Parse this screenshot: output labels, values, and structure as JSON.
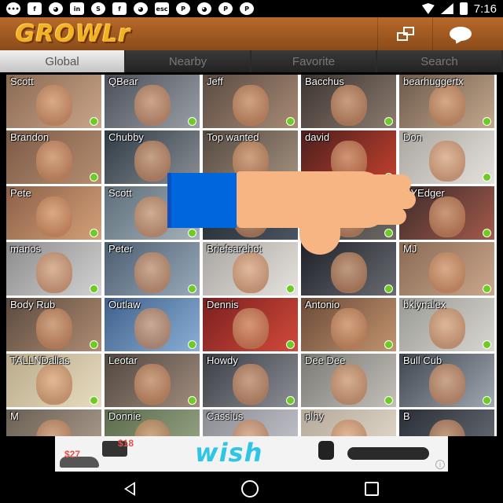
{
  "status_bar": {
    "time": "7:16",
    "notification_icons": [
      "messenger-icon",
      "facebook-icon",
      "growl-icon",
      "linkedin-icon",
      "skype-icon",
      "facebook-icon",
      "growl-icon",
      "esc-icon",
      "pinterest-icon",
      "growl-icon",
      "pinterest-icon",
      "pinterest-icon"
    ],
    "right_icons": [
      "wifi-icon",
      "signal-icon",
      "battery-icon"
    ]
  },
  "header": {
    "logo": "GROWLr",
    "actions": [
      "windows-icon",
      "chat-icon"
    ]
  },
  "tabs": [
    {
      "label": "Global",
      "active": true
    },
    {
      "label": "Nearby",
      "active": false
    },
    {
      "label": "Favorite",
      "active": false
    },
    {
      "label": "Search",
      "active": false
    }
  ],
  "users": [
    {
      "name": "Scott",
      "online": true
    },
    {
      "name": "QBear",
      "online": true
    },
    {
      "name": "Jeff",
      "online": true
    },
    {
      "name": "Bacchus",
      "online": true
    },
    {
      "name": "bearhuggertx",
      "online": true
    },
    {
      "name": "Brandon",
      "online": true
    },
    {
      "name": "Chubby",
      "online": true
    },
    {
      "name": "Top wanted",
      "online": true
    },
    {
      "name": "david",
      "online": true
    },
    {
      "name": "Don",
      "online": true
    },
    {
      "name": "Pete",
      "online": true
    },
    {
      "name": "Scott",
      "online": true
    },
    {
      "name": "",
      "online": false
    },
    {
      "name": "",
      "online": true
    },
    {
      "name": "NYEdger",
      "online": true
    },
    {
      "name": "manos",
      "online": true
    },
    {
      "name": "Peter",
      "online": true
    },
    {
      "name": "Briefsarehot",
      "online": true
    },
    {
      "name": "",
      "online": true
    },
    {
      "name": "MJ",
      "online": true
    },
    {
      "name": "Body Rub",
      "online": true
    },
    {
      "name": "Outlaw",
      "online": true
    },
    {
      "name": "Dennis",
      "online": true
    },
    {
      "name": "Antonio",
      "online": true
    },
    {
      "name": "bklynalex",
      "online": true
    },
    {
      "name": "TALLNDallas",
      "online": true
    },
    {
      "name": "Leotar",
      "online": true
    },
    {
      "name": "Howdy",
      "online": true
    },
    {
      "name": "Dee Dee",
      "online": true
    },
    {
      "name": "Bull Cub",
      "online": true
    },
    {
      "name": "M",
      "online": false
    },
    {
      "name": "Donnie",
      "online": false
    },
    {
      "name": "Cassius",
      "online": false
    },
    {
      "name": "plhy",
      "online": false
    },
    {
      "name": "B",
      "online": false
    }
  ],
  "overlay": {
    "icon": "thumbs-down-icon"
  },
  "ad": {
    "brand": "wish",
    "prices": [
      "$27",
      "$18"
    ],
    "info_icon": "i"
  },
  "nav": [
    "back-icon",
    "home-icon",
    "recent-apps-icon"
  ]
}
